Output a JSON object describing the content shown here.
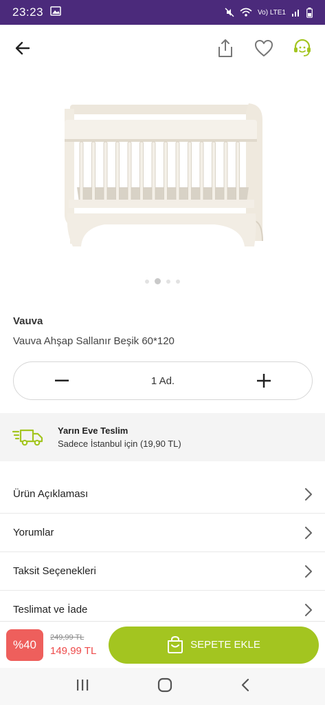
{
  "status": {
    "time": "23:23",
    "network": "Vo) LTE1"
  },
  "product": {
    "brand": "Vauva",
    "name": "Vauva Ahşap Sallanır Beşik 60*120"
  },
  "gallery": {
    "count": 4,
    "active": 2
  },
  "quantity": {
    "value": "1 Ad."
  },
  "delivery": {
    "title": "Yarın Eve Teslim",
    "subtitle": "Sadece İstanbul için (19,90 TL)"
  },
  "menu": {
    "items": [
      {
        "label": "Ürün Açıklaması"
      },
      {
        "label": "Yorumlar"
      },
      {
        "label": "Taksit Seçenekleri"
      },
      {
        "label": "Teslimat ve İade"
      }
    ]
  },
  "pricing": {
    "discount": "%40",
    "old_price": "249,99 TL",
    "new_price": "149,99 TL"
  },
  "cart": {
    "label": "SEPETE EKLE"
  },
  "colors": {
    "status_bar": "#4b2a7b",
    "accent_green": "#a3c520",
    "discount_red": "#ee5f5c"
  },
  "icons": [
    "back-arrow-icon",
    "share-icon",
    "heart-icon",
    "support-icon",
    "minus-icon",
    "plus-icon",
    "truck-icon",
    "chevron-right-icon",
    "bag-icon"
  ]
}
